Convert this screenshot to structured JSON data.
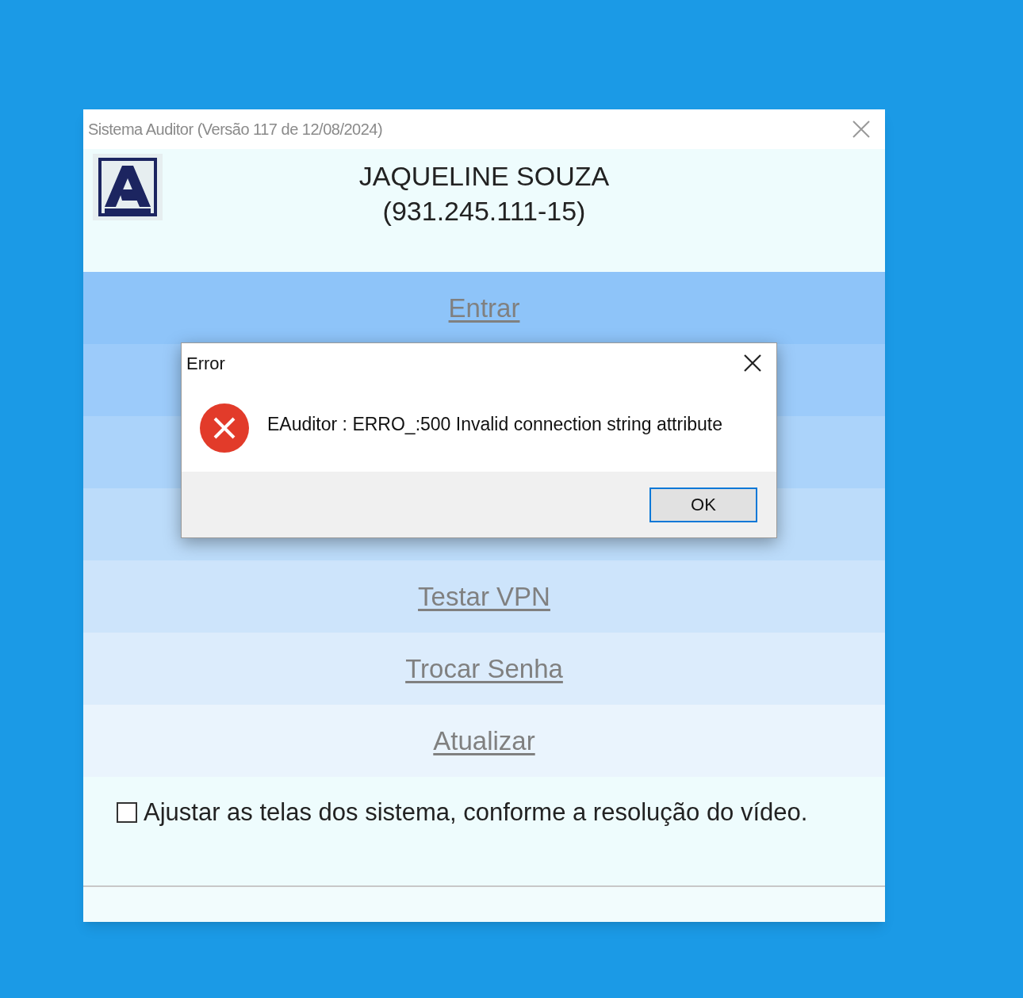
{
  "window": {
    "title": "Sistema Auditor (Versão 117 de 12/08/2024)",
    "user_name": "JAQUELINE SOUZA",
    "user_id": "(931.245.111-15)",
    "menu": [
      {
        "label": "Entrar"
      },
      {
        "label": "Testar VPN"
      },
      {
        "label": "Trocar Senha"
      },
      {
        "label": "Atualizar"
      }
    ],
    "adjust_checkbox": {
      "label": "Ajustar as telas dos sistema, conforme a resolução do vídeo.",
      "checked": false
    }
  },
  "dialog": {
    "title": "Error",
    "message": "EAuditor : ERRO_:500 Invalid connection string attribute",
    "buttons": [
      {
        "label": "OK",
        "default": true
      }
    ]
  }
}
